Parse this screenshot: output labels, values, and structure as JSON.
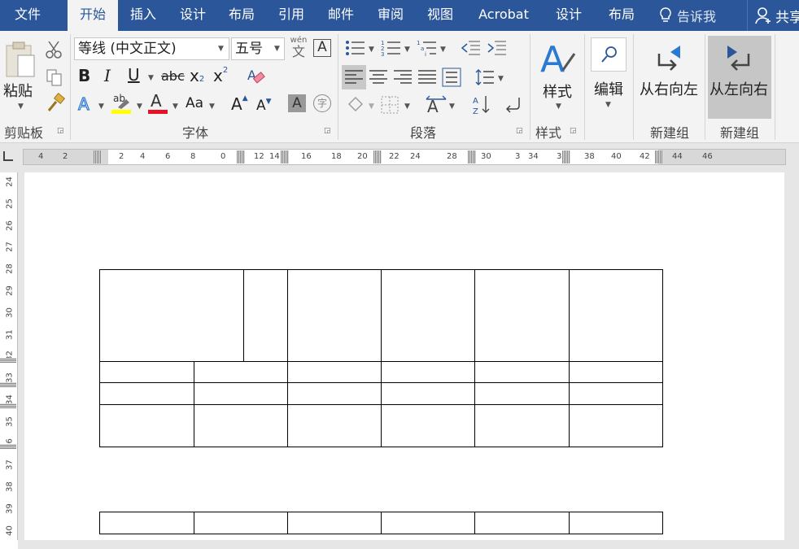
{
  "tabs": [
    {
      "label": "文件",
      "active": false
    },
    {
      "label": "开始",
      "active": true
    },
    {
      "label": "插入",
      "active": false
    },
    {
      "label": "设计",
      "active": false
    },
    {
      "label": "布局",
      "active": false
    },
    {
      "label": "引用",
      "active": false
    },
    {
      "label": "邮件",
      "active": false
    },
    {
      "label": "审阅",
      "active": false
    },
    {
      "label": "视图",
      "active": false
    },
    {
      "label": "Acrobat",
      "active": false
    },
    {
      "label": "设计",
      "active": false
    },
    {
      "label": "布局",
      "active": false
    }
  ],
  "tell_me": "告诉我",
  "share": "共享",
  "clipboard": {
    "paste_label": "粘贴",
    "group_label": "剪贴板"
  },
  "font": {
    "name": "等线 (中文正文)",
    "size": "五号",
    "group_label": "字体",
    "phonetic_top": "wén",
    "phonetic_bottom": "文",
    "border_char": "A",
    "bold": "B",
    "italic": "I",
    "underline": "U",
    "strike": "abc",
    "sub": "x",
    "sup": "x",
    "case": "Aa",
    "grow": "A",
    "shrink": "A",
    "shade": "A",
    "enclose": "字",
    "highlight_color": "#ffff00",
    "font_color": "#e81123"
  },
  "paragraph": {
    "group_label": "段落"
  },
  "styles": {
    "label": "样式",
    "group_label": "样式"
  },
  "editing": {
    "label": "编辑"
  },
  "custom1": {
    "label": "从右向左",
    "group_label": "新建组"
  },
  "custom2": {
    "label": "从左向右",
    "group_label": "新建组"
  },
  "hruler_numbers": [
    "4",
    "2",
    "2",
    "4",
    "6",
    "8",
    "0",
    "12",
    "14",
    "16",
    "18",
    "20",
    "22",
    "24",
    "28",
    "30",
    "3",
    "34",
    "36",
    "38",
    "40",
    "42",
    "44",
    "46"
  ],
  "vruler_numbers": [
    "24",
    "25",
    "26",
    "27",
    "28",
    "29",
    "30",
    "31",
    "32",
    "33",
    "34",
    "35",
    "36",
    "37",
    "38",
    "39",
    "40"
  ],
  "accent_color": "#2b579a"
}
